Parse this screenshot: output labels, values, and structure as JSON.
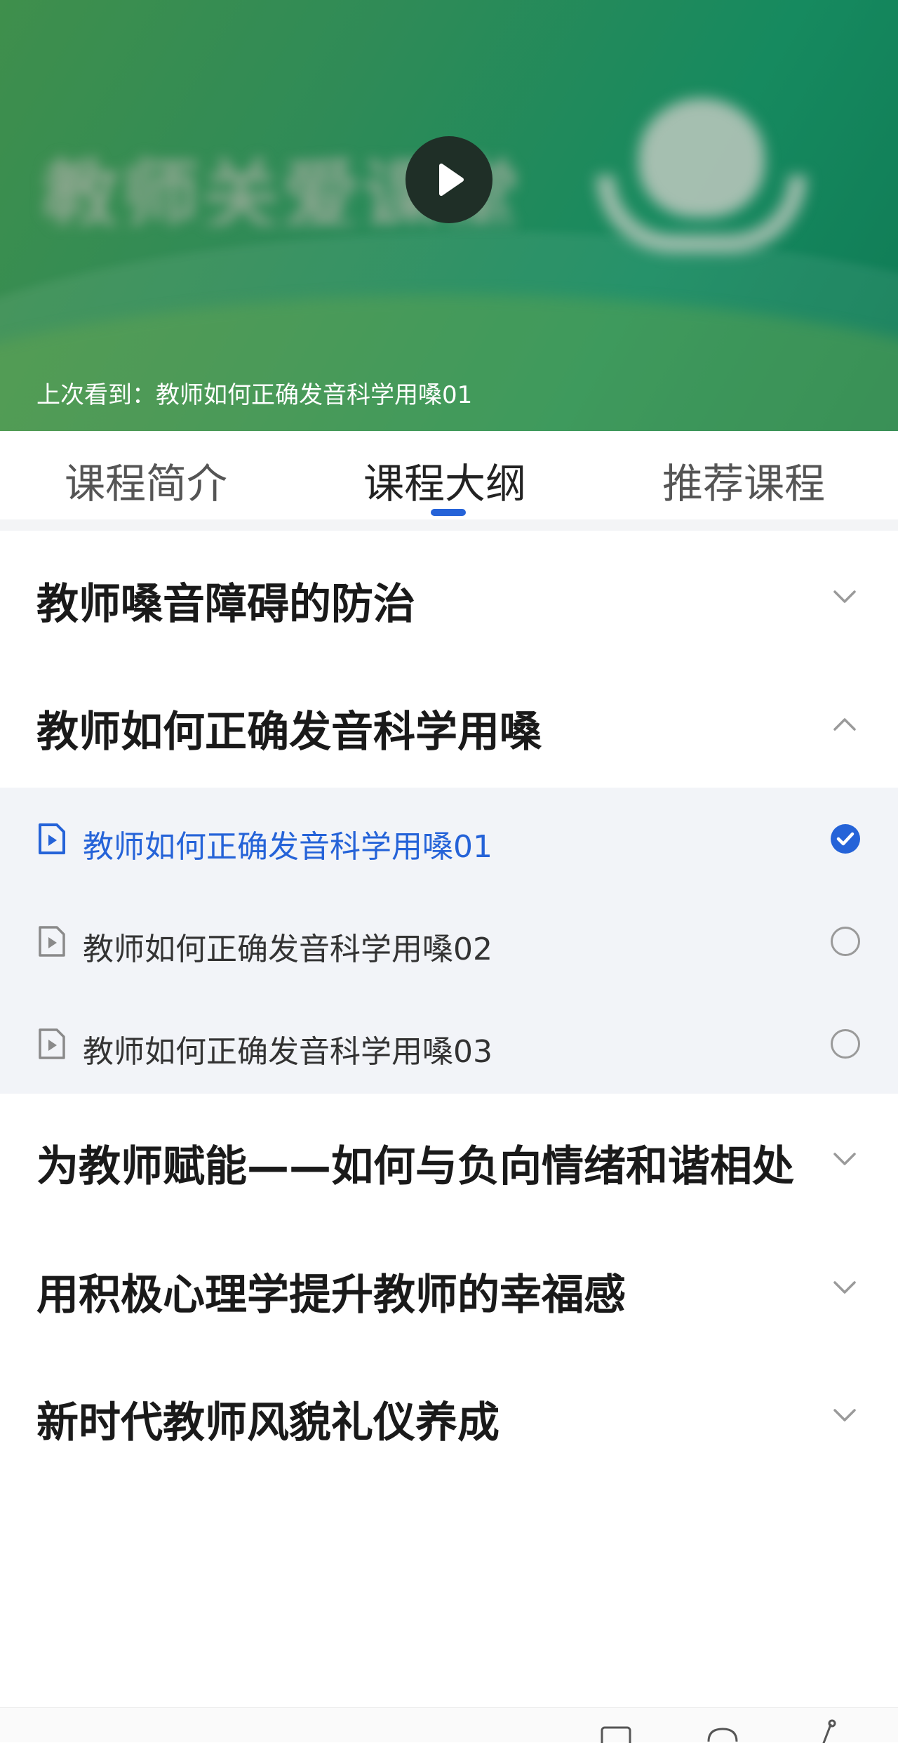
{
  "video": {
    "last_watched": "上次看到：教师如何正确发音科学用嗓01",
    "banner_title": "教师关爱课堂",
    "play_icon": "play-icon"
  },
  "tabs": [
    {
      "label": "课程简介",
      "active": false
    },
    {
      "label": "课程大纲",
      "active": true
    },
    {
      "label": "推荐课程",
      "active": false
    }
  ],
  "chapters": [
    {
      "title": "教师嗓音障碍的防治",
      "expanded": false,
      "icon": "chevron-down-icon"
    },
    {
      "title": "教师如何正确发音科学用嗓",
      "expanded": true,
      "icon": "chevron-up-icon",
      "lessons": [
        {
          "label": "教师如何正确发音科学用嗓01",
          "status": "completed",
          "active": true
        },
        {
          "label": "教师如何正确发音科学用嗓02",
          "status": "not-started",
          "active": false
        },
        {
          "label": "教师如何正确发音科学用嗓03",
          "status": "not-started",
          "active": false
        }
      ]
    },
    {
      "title": "为教师赋能——如何与负向情绪和谐相处",
      "expanded": false,
      "icon": "chevron-down-icon"
    },
    {
      "title": "用积极心理学提升教师的幸福感",
      "expanded": false,
      "icon": "chevron-down-icon"
    },
    {
      "title": "新时代教师风貌礼仪养成",
      "expanded": false,
      "icon": "chevron-down-icon"
    }
  ],
  "colors": {
    "accent": "#2563d8",
    "banner_green": "#168a5f",
    "lesson_background": "#f2f4f8"
  }
}
